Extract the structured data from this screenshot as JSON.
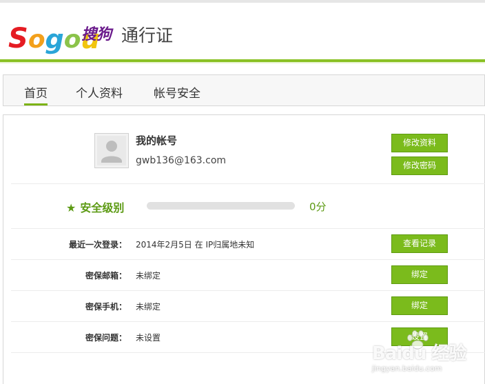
{
  "header": {
    "logo_letters": [
      "S",
      "o",
      "g",
      "o",
      "u"
    ],
    "logo_cn": "搜狗",
    "title": "通行证"
  },
  "tabs": [
    {
      "label": "首页",
      "active": true
    },
    {
      "label": "个人资料",
      "active": false
    },
    {
      "label": "帐号安全",
      "active": false
    }
  ],
  "account": {
    "title": "我的帐号",
    "email": "gwb136@163.com",
    "edit_profile_button": "修改资料",
    "change_password_button": "修改密码"
  },
  "security": {
    "star": "★",
    "label": "安全级别",
    "progress_percent": 0,
    "score": "0分"
  },
  "rows": [
    {
      "label": "最近一次登录：",
      "value": "2014年2月5日 在 IP归属地未知",
      "button": "查看记录"
    },
    {
      "label": "密保邮箱：",
      "value": "未绑定",
      "button": "绑定"
    },
    {
      "label": "密保手机：",
      "value": "未绑定",
      "button": "绑定"
    },
    {
      "label": "密保问题：",
      "value": "未设置",
      "button": "设置"
    }
  ],
  "watermark": {
    "text": "Baidu 经验",
    "sub": "jingyan.baidu.com"
  },
  "colors": {
    "accent_green": "#7bbb1c",
    "header_bar": "#8ac125",
    "security_text": "#5c9a13"
  }
}
